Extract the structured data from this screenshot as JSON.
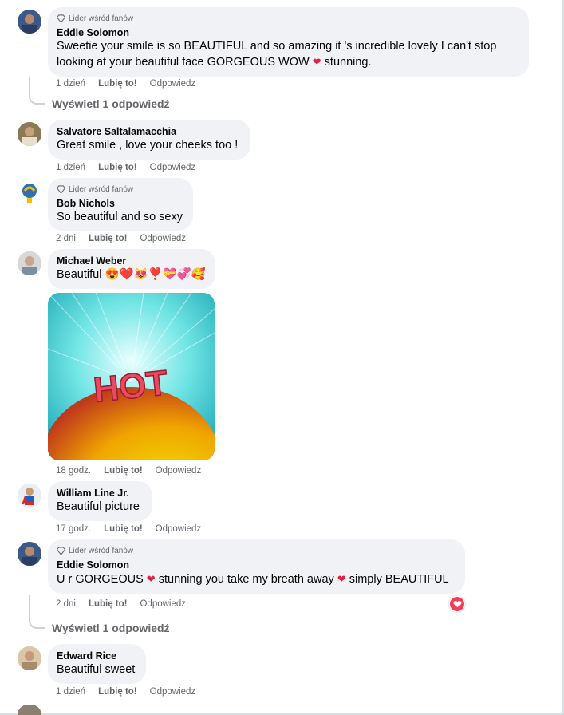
{
  "fan_badge": "Lider wśród fanów",
  "actions": {
    "like": "Lubię to!",
    "reply": "Odpowiedz"
  },
  "view_replies": "Wyświetl 1 odpowiedź",
  "comments": [
    {
      "author": "Eddie Solomon",
      "badge": true,
      "text_parts": [
        "Sweetie your smile is so BEAUTIFUL and so amazing it 's incredible lovely I can't stop",
        "looking at your beautiful face GORGEOUS WOW ",
        "❤",
        " stunning."
      ],
      "time": "1 dzień"
    },
    {
      "author": "Salvatore Saltalamacchia",
      "badge": false,
      "text": "Great smile , love your cheeks too !",
      "time": "1 dzień"
    },
    {
      "author": "Bob Nichols",
      "badge": true,
      "text": "So beautiful and so sexy",
      "time": "2 dni"
    },
    {
      "author": "Michael Weber",
      "badge": false,
      "text": "Beautiful 😍❤️😻❣️💝💞🥰",
      "time": "18 godz.",
      "image_text": "HOT"
    },
    {
      "author": "William Line Jr.",
      "badge": false,
      "text": "Beautiful picture",
      "time": "17 godz."
    },
    {
      "author": "Eddie Solomon",
      "badge": true,
      "text_parts": [
        "U r GORGEOUS ",
        "❤",
        " stunning you take my breath away ",
        "❤",
        " simply BEAUTIFUL"
      ],
      "time": "2 dni",
      "reaction_icon": "heart-reaction-icon"
    },
    {
      "author": "Edward Rice",
      "badge": false,
      "text": "Beautiful sweet",
      "time": "1 dzień"
    }
  ],
  "colors": {
    "bubble": "#f0f2f5",
    "meta": "#65676b",
    "heart": "#e41e3f",
    "reaction": "#f33e58"
  }
}
